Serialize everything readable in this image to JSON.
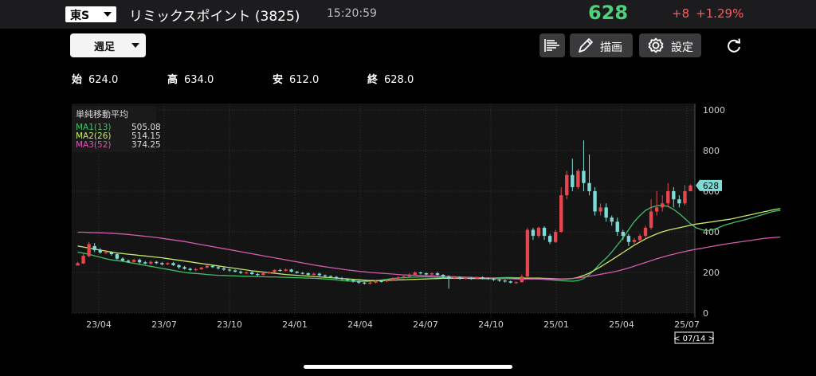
{
  "header": {
    "exchange_label": "東S",
    "stock_name": "リミックスポイント (3825)",
    "time": "15:20:59",
    "price": "628",
    "change": "+8",
    "change_pct": "+1.29%"
  },
  "toolbar": {
    "period_label": "週足",
    "draw_label": "描画",
    "settings_label": "設定"
  },
  "ohlc": {
    "open_label": "始",
    "open": "624.0",
    "high_label": "高",
    "high": "634.0",
    "low_label": "安",
    "low": "612.0",
    "close_label": "終",
    "close": "628.0"
  },
  "legend": {
    "title": "単純移動平均",
    "ma1_label": "MA1(13)",
    "ma1_value": "505.08",
    "ma2_label": "MA2(26)",
    "ma2_value": "514.15",
    "ma3_label": "MA3(52)",
    "ma3_value": "374.25"
  },
  "current_date": "< 07/14 >",
  "colors": {
    "up": "#e8464e",
    "down": "#7fdbd6",
    "ma1": "#3fbf6a",
    "ma2": "#c6e86a",
    "ma3": "#d25bb0",
    "price_up": "#4fd17a",
    "change": "#ff5a5a"
  },
  "chart_data": {
    "type": "candlestick",
    "ylim": [
      0,
      1000
    ],
    "y_ticks": [
      "0",
      "200",
      "400",
      "600",
      "800",
      "1000"
    ],
    "x_ticks": [
      "23/04",
      "23/07",
      "23/10",
      "24/01",
      "24/04",
      "24/07",
      "24/10",
      "25/01",
      "25/04",
      "25/07"
    ],
    "last_price_label": "628",
    "last_price": 628,
    "ma_series": [
      {
        "name": "MA1(13)",
        "values": [
          300,
          295,
          290,
          282,
          275,
          268,
          262,
          258,
          255,
          250,
          245,
          240,
          235,
          230,
          225,
          220,
          215,
          210,
          205,
          200,
          197,
          195,
          193,
          190,
          188,
          186,
          185,
          184,
          183,
          182,
          181,
          180,
          180,
          179,
          178,
          178,
          177,
          176,
          175,
          174,
          173,
          172,
          171,
          170,
          168,
          166,
          163,
          160,
          158,
          157,
          156,
          156,
          157,
          159,
          162,
          166,
          170,
          172,
          174,
          176,
          177,
          178,
          178,
          177,
          176,
          175,
          174,
          173,
          172,
          171,
          170,
          170,
          171,
          172,
          173,
          174,
          175,
          175,
          174,
          173,
          172,
          170,
          168,
          166,
          164,
          162,
          160,
          158,
          157,
          160,
          170,
          190,
          215,
          245,
          270,
          300,
          335,
          370,
          410,
          450,
          480,
          505,
          520,
          528,
          530,
          525,
          510,
          490,
          465,
          440,
          420,
          410,
          405,
          410,
          420,
          432,
          440,
          448,
          455,
          462,
          470,
          478,
          486,
          495,
          502,
          505
        ]
      },
      {
        "name": "MA2(26)",
        "values": [
          330,
          325,
          320,
          315,
          310,
          305,
          300,
          296,
          293,
          290,
          287,
          284,
          281,
          278,
          275,
          272,
          268,
          264,
          260,
          256,
          252,
          248,
          244,
          240,
          236,
          232,
          228,
          224,
          220,
          216,
          212,
          208,
          205,
          202,
          199,
          196,
          193,
          190,
          188,
          186,
          184,
          182,
          180,
          178,
          176,
          174,
          172,
          170,
          168,
          166,
          164,
          162,
          160,
          160,
          160,
          161,
          162,
          163,
          164,
          165,
          166,
          167,
          168,
          169,
          170,
          171,
          171,
          171,
          171,
          171,
          171,
          171,
          170,
          170,
          170,
          170,
          170,
          171,
          171,
          172,
          172,
          172,
          172,
          171,
          170,
          169,
          168,
          168,
          170,
          176,
          185,
          197,
          212,
          228,
          245,
          262,
          280,
          298,
          316,
          334,
          350,
          365,
          378,
          390,
          400,
          408,
          414,
          420,
          426,
          432,
          438,
          442,
          446,
          450,
          454,
          458,
          462,
          468,
          474,
          480,
          486,
          492,
          498,
          504,
          510,
          514
        ]
      },
      {
        "name": "MA3(52)",
        "values": [
          398,
          398,
          397,
          396,
          395,
          394,
          393,
          391,
          389,
          387,
          384,
          381,
          378,
          375,
          372,
          368,
          364,
          360,
          356,
          352,
          347,
          342,
          337,
          332,
          327,
          322,
          317,
          312,
          307,
          302,
          297,
          292,
          287,
          282,
          277,
          272,
          267,
          262,
          257,
          252,
          247,
          242,
          237,
          232,
          228,
          224,
          220,
          216,
          212,
          209,
          206,
          203,
          200,
          198,
          196,
          194,
          192,
          190,
          188,
          187,
          186,
          185,
          184,
          183,
          182,
          181,
          180,
          179,
          178,
          177,
          176,
          175,
          174,
          173,
          172,
          171,
          170,
          169,
          168,
          168,
          168,
          168,
          168,
          168,
          168,
          168,
          168,
          169,
          170,
          173,
          177,
          181,
          186,
          191,
          196,
          201,
          207,
          214,
          222,
          231,
          240,
          249,
          258,
          267,
          275,
          283,
          290,
          297,
          303,
          309,
          314,
          319,
          324,
          329,
          334,
          339,
          343,
          347,
          351,
          355,
          359,
          363,
          367,
          370,
          372,
          374
        ]
      }
    ],
    "candles": [
      [
        234,
        246,
        240,
        252
      ],
      [
        244,
        282,
        242,
        290
      ],
      [
        280,
        340,
        275,
        350
      ],
      [
        330,
        310,
        300,
        345
      ],
      [
        312,
        298,
        292,
        320
      ],
      [
        298,
        300,
        290,
        310
      ],
      [
        300,
        290,
        282,
        305
      ],
      [
        290,
        268,
        262,
        296
      ],
      [
        268,
        258,
        254,
        275
      ],
      [
        258,
        252,
        248,
        264
      ],
      [
        252,
        262,
        246,
        268
      ],
      [
        262,
        250,
        242,
        268
      ],
      [
        250,
        244,
        240,
        256
      ],
      [
        244,
        252,
        238,
        258
      ],
      [
        252,
        246,
        240,
        258
      ],
      [
        246,
        240,
        234,
        252
      ],
      [
        240,
        246,
        236,
        250
      ],
      [
        246,
        236,
        232,
        252
      ],
      [
        236,
        226,
        218,
        240
      ],
      [
        226,
        218,
        214,
        232
      ],
      [
        218,
        212,
        206,
        224
      ],
      [
        212,
        216,
        206,
        222
      ],
      [
        216,
        224,
        212,
        228
      ],
      [
        224,
        232,
        220,
        238
      ],
      [
        232,
        226,
        222,
        236
      ],
      [
        226,
        220,
        214,
        230
      ],
      [
        220,
        214,
        208,
        226
      ],
      [
        214,
        210,
        204,
        218
      ],
      [
        210,
        204,
        200,
        214
      ],
      [
        204,
        198,
        192,
        210
      ],
      [
        198,
        200,
        192,
        206
      ],
      [
        200,
        192,
        188,
        206
      ],
      [
        192,
        188,
        182,
        198
      ],
      [
        188,
        196,
        184,
        200
      ],
      [
        196,
        202,
        192,
        206
      ],
      [
        202,
        212,
        198,
        216
      ],
      [
        212,
        208,
        204,
        218
      ],
      [
        208,
        214,
        204,
        220
      ],
      [
        214,
        204,
        200,
        218
      ],
      [
        204,
        198,
        194,
        208
      ],
      [
        198,
        196,
        190,
        202
      ],
      [
        196,
        188,
        184,
        200
      ],
      [
        188,
        194,
        184,
        198
      ],
      [
        194,
        186,
        182,
        198
      ],
      [
        186,
        182,
        178,
        190
      ],
      [
        182,
        178,
        172,
        186
      ],
      [
        178,
        172,
        166,
        182
      ],
      [
        172,
        168,
        162,
        178
      ],
      [
        168,
        162,
        156,
        172
      ],
      [
        162,
        156,
        150,
        166
      ],
      [
        156,
        150,
        144,
        160
      ],
      [
        150,
        146,
        140,
        154
      ],
      [
        146,
        150,
        140,
        156
      ],
      [
        150,
        158,
        146,
        162
      ],
      [
        158,
        156,
        150,
        162
      ],
      [
        156,
        162,
        152,
        166
      ],
      [
        162,
        170,
        158,
        176
      ],
      [
        170,
        176,
        166,
        182
      ],
      [
        176,
        180,
        172,
        186
      ],
      [
        180,
        188,
        176,
        196
      ],
      [
        188,
        200,
        186,
        206
      ],
      [
        200,
        196,
        190,
        204
      ],
      [
        196,
        190,
        186,
        200
      ],
      [
        190,
        196,
        184,
        200
      ],
      [
        196,
        188,
        184,
        202
      ],
      [
        188,
        180,
        174,
        192
      ],
      [
        180,
        172,
        120,
        186
      ],
      [
        172,
        176,
        166,
        182
      ],
      [
        176,
        170,
        164,
        180
      ],
      [
        170,
        174,
        164,
        178
      ],
      [
        174,
        170,
        164,
        178
      ],
      [
        170,
        176,
        166,
        180
      ],
      [
        176,
        172,
        166,
        180
      ],
      [
        172,
        168,
        164,
        176
      ],
      [
        168,
        164,
        158,
        172
      ],
      [
        164,
        160,
        154,
        168
      ],
      [
        160,
        156,
        150,
        164
      ],
      [
        156,
        150,
        146,
        160
      ],
      [
        150,
        152,
        144,
        156
      ],
      [
        152,
        180,
        150,
        190
      ],
      [
        180,
        410,
        176,
        420
      ],
      [
        410,
        380,
        360,
        420
      ],
      [
        380,
        420,
        370,
        425
      ],
      [
        420,
        380,
        360,
        428
      ],
      [
        380,
        350,
        340,
        390
      ],
      [
        350,
        400,
        345,
        410
      ],
      [
        400,
        580,
        395,
        620
      ],
      [
        580,
        680,
        560,
        700
      ],
      [
        680,
        620,
        600,
        760
      ],
      [
        620,
        700,
        610
      ],
      [
        700,
        640,
        600,
        850
      ],
      [
        640,
        600,
        580,
        780
      ],
      [
        600,
        500,
        480,
        620
      ],
      [
        500,
        520,
        480,
        540
      ],
      [
        520,
        470,
        450,
        540
      ],
      [
        470,
        450,
        430,
        480
      ],
      [
        450,
        400,
        380,
        470
      ],
      [
        400,
        380,
        360,
        410
      ],
      [
        380,
        350,
        330,
        390
      ],
      [
        350,
        360,
        340,
        370
      ],
      [
        360,
        380,
        350,
        390
      ],
      [
        380,
        420,
        370,
        430
      ],
      [
        420,
        500,
        410,
        560
      ],
      [
        500,
        520,
        480,
        600
      ],
      [
        520,
        540,
        500,
        580
      ],
      [
        540,
        600,
        520,
        640
      ],
      [
        600,
        560,
        520,
        620
      ],
      [
        560,
        540,
        520,
        580
      ],
      [
        540,
        600,
        530,
        630
      ],
      [
        600,
        628,
        612,
        634
      ]
    ]
  }
}
